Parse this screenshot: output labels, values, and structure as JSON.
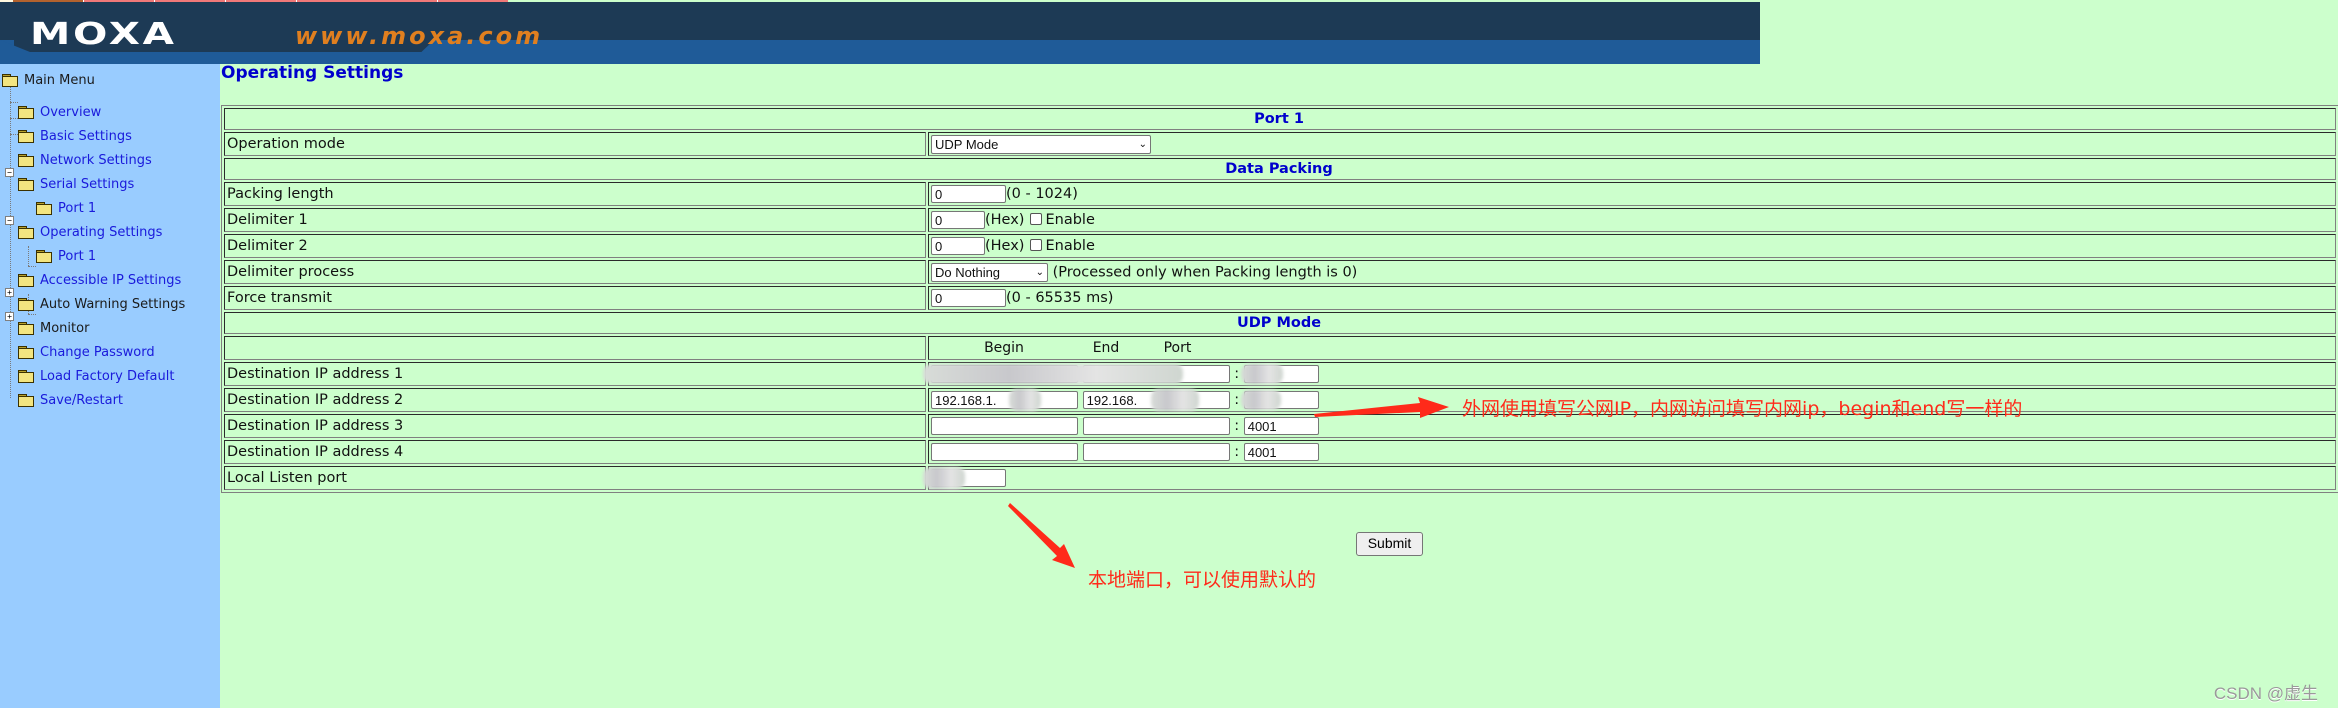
{
  "banner": {
    "logo": "MOXA",
    "url": "www.moxa.com",
    "colors": {
      "dark": "#1d3a55",
      "blue": "#1f5b98",
      "url": "#e07f1f"
    }
  },
  "sidebar": {
    "items": [
      {
        "label": "Main Menu",
        "level": 0,
        "expanded": true
      },
      {
        "label": "Overview",
        "level": 1
      },
      {
        "label": "Basic Settings",
        "level": 1
      },
      {
        "label": "Network Settings",
        "level": 1
      },
      {
        "label": "Serial Settings",
        "level": 1,
        "expanded": true
      },
      {
        "label": "Port 1",
        "level": 2
      },
      {
        "label": "Operating Settings",
        "level": 1,
        "expanded": true
      },
      {
        "label": "Port 1",
        "level": 2
      },
      {
        "label": "Accessible IP Settings",
        "level": 1
      },
      {
        "label": "Auto Warning Settings",
        "level": 1,
        "expanded": false
      },
      {
        "label": "Monitor",
        "level": 1,
        "expanded": false
      },
      {
        "label": "Change Password",
        "level": 1
      },
      {
        "label": "Load Factory Default",
        "level": 1
      },
      {
        "label": "Save/Restart",
        "level": 1
      }
    ]
  },
  "page": {
    "title": "Operating Settings",
    "sections": {
      "port": "Port 1",
      "data_packing": "Data Packing",
      "udp_mode": "UDP Mode"
    },
    "operation_mode": {
      "label": "Operation mode",
      "value": "UDP Mode"
    },
    "packing_length": {
      "label": "Packing length",
      "value": "0",
      "hint": "(0 - 1024)"
    },
    "delimiter1": {
      "label": "Delimiter 1",
      "value": "0",
      "unit": "(Hex)",
      "enable_label": "Enable",
      "enabled": false
    },
    "delimiter2": {
      "label": "Delimiter 2",
      "value": "0",
      "unit": "(Hex)",
      "enable_label": "Enable",
      "enabled": false
    },
    "delimiter_process": {
      "label": "Delimiter process",
      "value": "Do Nothing",
      "hint": "(Processed only when Packing length is 0)"
    },
    "force_transmit": {
      "label": "Force transmit",
      "value": "0",
      "hint": "(0 - 65535 ms)"
    },
    "dest_headers": {
      "begin": "Begin",
      "end": "End",
      "port": "Port"
    },
    "destinations": [
      {
        "label": "Destination IP address 1",
        "begin": "",
        "end": "",
        "port": "",
        "redacted": true
      },
      {
        "label": "Destination IP address 2",
        "begin": "192.168.1.",
        "end": "192.168.",
        "port": "",
        "redacted": true
      },
      {
        "label": "Destination IP address 3",
        "begin": "",
        "end": "",
        "port": "4001"
      },
      {
        "label": "Destination IP address 4",
        "begin": "",
        "end": "",
        "port": "4001"
      }
    ],
    "port_separator": ":",
    "local_listen_port": {
      "label": "Local Listen port",
      "value": "",
      "redacted": true
    },
    "submit_label": "Submit"
  },
  "annotations": {
    "dest_note": "外网使用填写公网IP，内网访问填写内网ip，begin和end写一样的",
    "local_note": "本地端口，可以使用默认的",
    "color": "#ff2a1a"
  },
  "watermark": "CSDN @虚生"
}
